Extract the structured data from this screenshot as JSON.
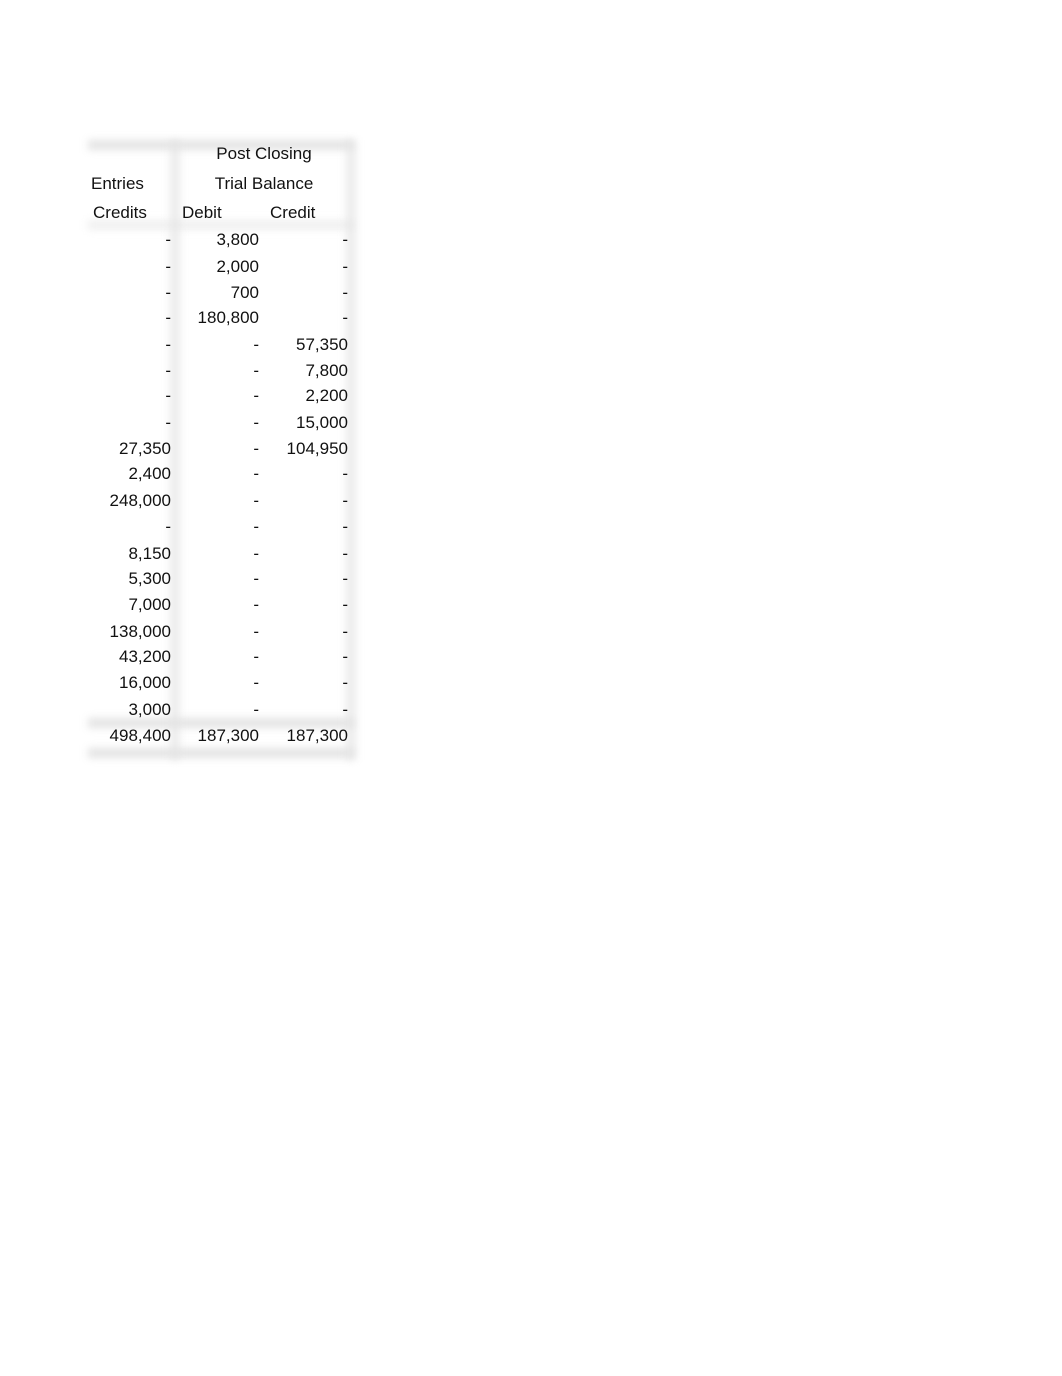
{
  "headers": {
    "group_left_line1": "Entries",
    "group_left_line2": "Credits",
    "group_right_line1": "Post Closing",
    "group_right_line2": "Trial Balance",
    "col_debit": "Debit",
    "col_credit": "Credit"
  },
  "rows": [
    {
      "credits": "-",
      "debit": "3,800",
      "credit": "-"
    },
    {
      "credits": "-",
      "debit": "2,000",
      "credit": "-"
    },
    {
      "credits": "-",
      "debit": "700",
      "credit": "-"
    },
    {
      "credits": "-",
      "debit": "180,800",
      "credit": "-"
    },
    {
      "credits": "-",
      "debit": "-",
      "credit": "57,350"
    },
    {
      "credits": "-",
      "debit": "-",
      "credit": "7,800"
    },
    {
      "credits": "-",
      "debit": "-",
      "credit": "2,200"
    },
    {
      "credits": "-",
      "debit": "-",
      "credit": "15,000"
    },
    {
      "credits": "27,350",
      "debit": "-",
      "credit": "104,950"
    },
    {
      "credits": "2,400",
      "debit": "-",
      "credit": "-"
    },
    {
      "credits": "248,000",
      "debit": "-",
      "credit": "-"
    },
    {
      "credits": "-",
      "debit": "-",
      "credit": "-"
    },
    {
      "credits": "8,150",
      "debit": "-",
      "credit": "-"
    },
    {
      "credits": "5,300",
      "debit": "-",
      "credit": "-"
    },
    {
      "credits": "7,000",
      "debit": "-",
      "credit": "-"
    },
    {
      "credits": "138,000",
      "debit": "-",
      "credit": "-"
    },
    {
      "credits": "43,200",
      "debit": "-",
      "credit": "-"
    },
    {
      "credits": "16,000",
      "debit": "-",
      "credit": "-"
    },
    {
      "credits": "3,000",
      "debit": "-",
      "credit": "-"
    }
  ],
  "totals": {
    "credits": "498,400",
    "debit": "187,300",
    "credit": "187,300"
  }
}
